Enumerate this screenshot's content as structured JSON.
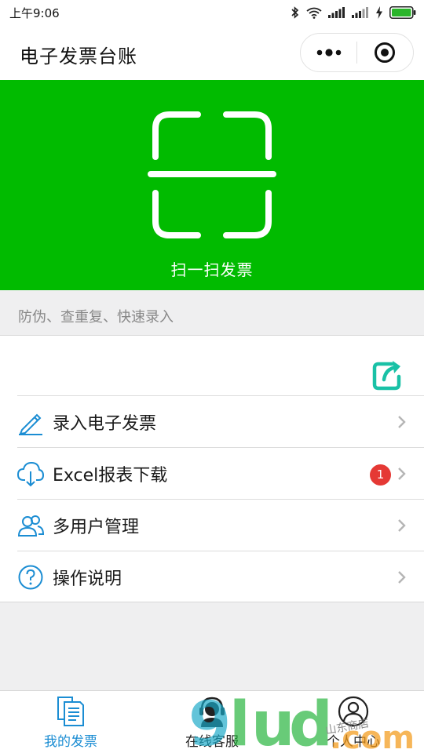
{
  "status_bar": {
    "time": "上午9:06"
  },
  "header": {
    "title": "电子发票台账"
  },
  "scan": {
    "label": "扫一扫发票",
    "bg_color": "#01bb00"
  },
  "subtitle": "防伪、查重复、快速录入",
  "menu": [
    {
      "label": "录入电子发票",
      "icon": "pencil-icon"
    },
    {
      "label": "Excel报表下载",
      "icon": "cloud-download-icon",
      "badge": "1"
    },
    {
      "label": "多用户管理",
      "icon": "users-icon"
    },
    {
      "label": "操作说明",
      "icon": "question-icon"
    }
  ],
  "tabs": [
    {
      "label": "我的发票",
      "icon": "invoice-icon",
      "active": true
    },
    {
      "label": "在线客服",
      "icon": "headset-icon"
    },
    {
      "label": "个人中心",
      "icon": "user-icon"
    }
  ],
  "accent_color": "#1b8dd3",
  "watermark": {
    "text": "9lud.com",
    "handwriting": "山东商店"
  }
}
